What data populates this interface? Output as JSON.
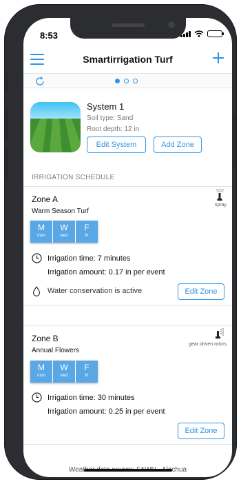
{
  "status_bar": {
    "time": "8:53"
  },
  "nav": {
    "title": "Smartirrigation Turf"
  },
  "pager": {
    "pages": 3,
    "active": 0
  },
  "system": {
    "name": "System 1",
    "soil_type": "Soil type: Sand",
    "root_depth": "Root depth: 12 in",
    "edit_label": "Edit System",
    "add_zone_label": "Add Zone"
  },
  "schedule": {
    "heading": "IRRIGATION SCHEDULE"
  },
  "zones": [
    {
      "name": "Zone A",
      "plant": "Warm Season Turf",
      "device_label": "spray",
      "days": [
        {
          "letter": "M",
          "short": "mon"
        },
        {
          "letter": "W",
          "short": "wed"
        },
        {
          "letter": "F",
          "short": "fri"
        }
      ],
      "irrigation_time": "Irrigation time: 7 minutes",
      "irrigation_amount": "Irrigation amount: 0.17 in per event",
      "conservation_note": "Water conservation is active",
      "edit_label": "Edit Zone"
    },
    {
      "name": "Zone B",
      "plant": "Annual Flowers",
      "device_label": "gear driven rotors",
      "days": [
        {
          "letter": "M",
          "short": "mon"
        },
        {
          "letter": "W",
          "short": "wed"
        },
        {
          "letter": "F",
          "short": "fri"
        }
      ],
      "irrigation_time": "Irrigation time: 30 minutes",
      "irrigation_amount": "Irrigation amount: 0.25 in per event",
      "edit_label": "Edit Zone"
    }
  ],
  "footer": {
    "weather_source": "Weather data source: FAWN - Alachua"
  },
  "colors": {
    "accent": "#2f94e6",
    "day_chip": "#5aa7e6",
    "frame": "#2b2d31"
  }
}
